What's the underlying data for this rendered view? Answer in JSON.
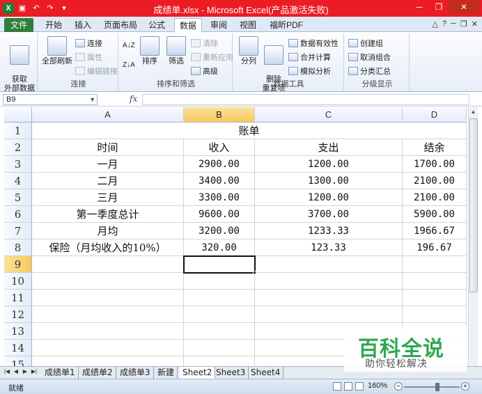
{
  "window": {
    "title": "成绩单.xlsx - Microsoft Excel(产品激活失败)",
    "logo": "X"
  },
  "tabs": [
    "文件",
    "开始",
    "插入",
    "页面布局",
    "公式",
    "数据",
    "审阅",
    "视图",
    "福昕PDF"
  ],
  "active_tab": "数据",
  "ribbon": {
    "get_external": "获取\n外部数据",
    "refresh_all": "全部刷新",
    "connections": "连接",
    "properties": "属性",
    "edit_links": "编辑链接",
    "group_connections": "连接",
    "sort_az": "A↓Z",
    "sort_za": "Z↓A",
    "sort": "排序",
    "filter": "筛选",
    "clear": "清除",
    "reapply": "重新应用",
    "advanced": "高级",
    "group_sort_filter": "排序和筛选",
    "text_to_columns": "分列",
    "remove_duplicates": "删除\n重复项",
    "data_validation": "数据有效性",
    "consolidate": "合并计算",
    "what_if": "模拟分析",
    "group_data_tools": "数据工具",
    "group": "创建组",
    "ungroup": "取消组合",
    "subtotal": "分类汇总",
    "group_outline": "分级显示"
  },
  "formula_bar": {
    "name_box": "B9",
    "fx": "fx",
    "formula": ""
  },
  "grid": {
    "columns": [
      "A",
      "B",
      "C",
      "D"
    ],
    "selected_column": "B",
    "rows": [
      "1",
      "2",
      "3",
      "4",
      "5",
      "6",
      "7",
      "8",
      "9",
      "10",
      "11",
      "12",
      "13",
      "14",
      "15"
    ],
    "selected_row": "9",
    "title": "账单",
    "headers": [
      "时间",
      "收入",
      "支出",
      "结余"
    ],
    "data": [
      [
        "一月",
        "2900.00",
        "1200.00",
        "1700.00"
      ],
      [
        "二月",
        "3400.00",
        "1300.00",
        "2100.00"
      ],
      [
        "三月",
        "3300.00",
        "1200.00",
        "2100.00"
      ],
      [
        "第一季度总计",
        "9600.00",
        "3700.00",
        "5900.00"
      ],
      [
        "月均",
        "3200.00",
        "1233.33",
        "1966.67"
      ],
      [
        "保险（月均收入的10%）",
        "320.00",
        "123.33",
        "196.67"
      ]
    ]
  },
  "sheets": [
    "成绩单1",
    "成绩单2",
    "成绩单3",
    "新建",
    "Sheet2",
    "Sheet3",
    "Sheet4"
  ],
  "active_sheet": "Sheet2",
  "status": {
    "ready": "就绪",
    "zoom": "160%",
    "zoom_level": 0.6
  },
  "watermark": {
    "brand": "百科全说",
    "slogan": "助你轻松解决"
  }
}
